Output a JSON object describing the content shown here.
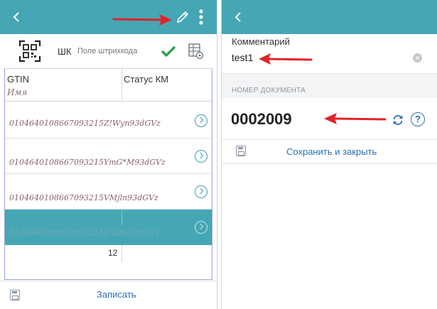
{
  "left_screen": {
    "scan_row": {
      "barcode_label": "ШК",
      "barcode_placeholder": "Поле штрихкода"
    },
    "table": {
      "headers": {
        "gtin": "GTIN",
        "status": "Статус КМ",
        "name": "Имя"
      },
      "rows": [
        {
          "gtin": "0104640108667093215Z!Wyn93dGVz",
          "selected": false
        },
        {
          "gtin": "0104640108667093215YmG*M93dGVz",
          "selected": false
        },
        {
          "gtin": "0104640108667093215VMjln93dGVz",
          "selected": false
        },
        {
          "gtin": "0104640108667093215gAa8d93dGVz",
          "selected": true
        }
      ],
      "total_count": "12"
    },
    "bottom_bar": {
      "write_label": "Записать"
    }
  },
  "right_screen": {
    "comment": {
      "label": "Комментарий",
      "value": "test1"
    },
    "section_header": "НОМЕР ДОКУМЕНТА",
    "document_number": "0002009",
    "help_glyph": "?",
    "save_close_label": "Сохранить и закрыть"
  },
  "icons": {
    "back": "back-arrow-icon",
    "edit": "pencil-icon",
    "more": "more-vertical-icon",
    "scan": "qr-scan-icon",
    "confirm": "check-icon",
    "table_settings": "table-settings-icon",
    "row_open": "chevron-right-circle-icon",
    "save": "floppy-disk-icon",
    "refresh": "refresh-icon",
    "help": "help-circle-icon",
    "clear": "clear-icon"
  },
  "colors": {
    "appbar": "#45a7b4",
    "selected_row": "#45a7b4",
    "link": "#2c6fb3",
    "check": "#2ea24a",
    "annotation_arrow": "#e2232a"
  }
}
